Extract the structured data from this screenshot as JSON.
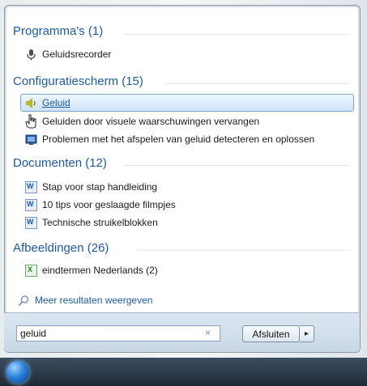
{
  "sections": [
    {
      "title": "Programma's (1)",
      "items": [
        {
          "label": "Geluidsrecorder",
          "icon": "microphone-icon"
        }
      ]
    },
    {
      "title": "Configuratiescherm (15)",
      "items": [
        {
          "label": "Geluid",
          "icon": "speaker-icon",
          "highlighted": true
        },
        {
          "label": "Geluiden door visuele waarschuwingen vervangen",
          "icon": "hand-cursor-icon"
        },
        {
          "label": "Problemen met het afspelen van geluid detecteren en oplossen",
          "icon": "monitor-icon"
        }
      ]
    },
    {
      "title": "Documenten (12)",
      "items": [
        {
          "label": "Stap voor stap handleiding",
          "icon": "word-document-icon"
        },
        {
          "label": "10 tips voor geslaagde filmpjes",
          "icon": "word-document-icon"
        },
        {
          "label": "Technische struikelblokken",
          "icon": "word-document-icon"
        }
      ]
    },
    {
      "title": "Afbeeldingen (26)",
      "items": [
        {
          "label": "eindtermen Nederlands (2)",
          "icon": "excel-document-icon"
        }
      ]
    }
  ],
  "more_results": "Meer resultaten weergeven",
  "search": {
    "value": "geluid",
    "clear_glyph": "×"
  },
  "shutdown": {
    "label": "Afsluiten",
    "arrow": "▸"
  },
  "colors": {
    "section_title": "#1d5aa5",
    "highlight": "#cfe3f8",
    "taskbar": "#2a3746"
  }
}
